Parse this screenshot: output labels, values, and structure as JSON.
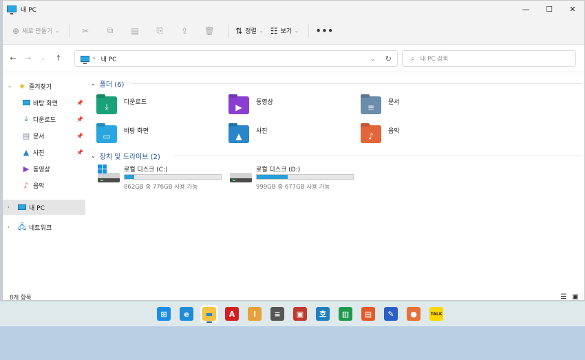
{
  "window": {
    "title": "내 PC",
    "minimize": "—",
    "maximize": "☐",
    "close": "✕"
  },
  "commandbar": {
    "new_label": "새로 만들기",
    "sort_label": "정렬",
    "view_label": "보기",
    "more_label": "•••"
  },
  "address": {
    "crumb": "내 PC",
    "search_placeholder": "내 PC 검색"
  },
  "sidebar": {
    "favorites": "즐겨찾기",
    "quick": [
      {
        "label": "바탕 화면",
        "icon": "desktop-icon",
        "color": "#2aa6e0"
      },
      {
        "label": "다운로드",
        "icon": "download-icon",
        "color": "#1aa179"
      },
      {
        "label": "문서",
        "icon": "document-icon",
        "color": "#7a8ea6"
      },
      {
        "label": "사진",
        "icon": "pictures-icon",
        "color": "#2a86c8"
      },
      {
        "label": "동영상",
        "icon": "videos-icon",
        "color": "#8a3fd1"
      },
      {
        "label": "음악",
        "icon": "music-icon",
        "color": "#e26a3a"
      }
    ],
    "this_pc": "내 PC",
    "network": "네트워크"
  },
  "folders": {
    "header": "폴더 (6)",
    "items": [
      {
        "label": "다운로드",
        "icon": "download-folder-icon",
        "color": "#1aa179"
      },
      {
        "label": "동영상",
        "icon": "videos-folder-icon",
        "color": "#8a3fd1"
      },
      {
        "label": "문서",
        "icon": "documents-folder-icon",
        "color": "#6c8cab"
      },
      {
        "label": "바탕 화면",
        "icon": "desktop-folder-icon",
        "color": "#2aa6e0"
      },
      {
        "label": "사진",
        "icon": "pictures-folder-icon",
        "color": "#2a86c8"
      },
      {
        "label": "음악",
        "icon": "music-folder-icon",
        "color": "#e2663a"
      }
    ]
  },
  "drives": {
    "header": "장치 및 드라이브 (2)",
    "items": [
      {
        "name": "로컬 디스크 (C:)",
        "free": "862GB 중 776GB 사용 가능",
        "used_fraction": 0.1
      },
      {
        "name": "로컬 디스크 (D:)",
        "free": "999GB 중 677GB 사용 가능",
        "used_fraction": 0.32
      }
    ]
  },
  "status": {
    "item_count": "8개 항목"
  },
  "taskbar": {
    "apps": [
      {
        "name": "start",
        "color": "#1a8ee6",
        "glyph": "⊞"
      },
      {
        "name": "edge",
        "color": "#1f8bd6",
        "glyph": "e"
      },
      {
        "name": "file-explorer",
        "color": "#f3c343",
        "glyph": "▬"
      },
      {
        "name": "acrobat",
        "color": "#d22020",
        "glyph": "A"
      },
      {
        "name": "hwp",
        "color": "#e8a03a",
        "glyph": "I"
      },
      {
        "name": "archive",
        "color": "#555555",
        "glyph": "≡"
      },
      {
        "name": "image-viewer",
        "color": "#c0392b",
        "glyph": "▣"
      },
      {
        "name": "hangul",
        "color": "#1f7fc0",
        "glyph": "호"
      },
      {
        "name": "hancell",
        "color": "#1e9a4d",
        "glyph": "▥"
      },
      {
        "name": "hanshow",
        "color": "#e05a2a",
        "glyph": "▤"
      },
      {
        "name": "hanword",
        "color": "#2a5fc7",
        "glyph": "✎"
      },
      {
        "name": "voice-recorder",
        "color": "#e8703a",
        "glyph": "●"
      },
      {
        "name": "kakaotalk",
        "color": "#f7d900",
        "glyph": "TALK"
      }
    ]
  }
}
